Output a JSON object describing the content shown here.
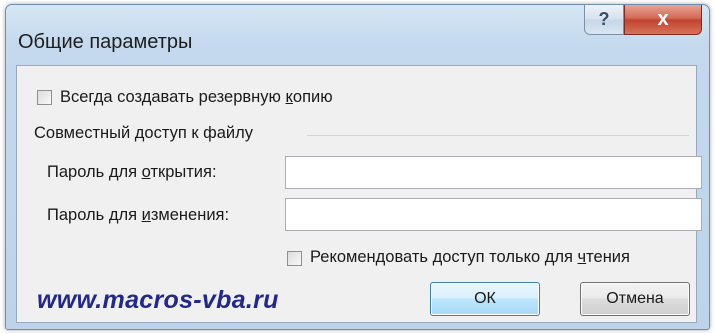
{
  "window": {
    "title": "Общие параметры",
    "help_glyph": "?",
    "close_glyph": "x"
  },
  "backup": {
    "label_pre": "Всегда создавать резервную ",
    "label_acc": "к",
    "label_post": "опию",
    "checked": false
  },
  "sharing": {
    "group_label": "Совместный доступ к файлу",
    "open_password_pre": "Пароль для ",
    "open_password_acc": "о",
    "open_password_post": "ткрытия:",
    "open_password_value": "",
    "modify_password_pre": "Пароль для ",
    "modify_password_acc": "и",
    "modify_password_post": "зменения:",
    "modify_password_value": "",
    "readonly_pre": "Рекомендовать доступ только для ",
    "readonly_acc": "ч",
    "readonly_post": "тения",
    "readonly_checked": false
  },
  "buttons": {
    "ok": "ОК",
    "cancel": "Отмена"
  },
  "watermark": "www.macros-vba.ru",
  "colors": {
    "frame": "#bcd3ea",
    "close": "#c0432c",
    "watermark": "#22288c"
  }
}
